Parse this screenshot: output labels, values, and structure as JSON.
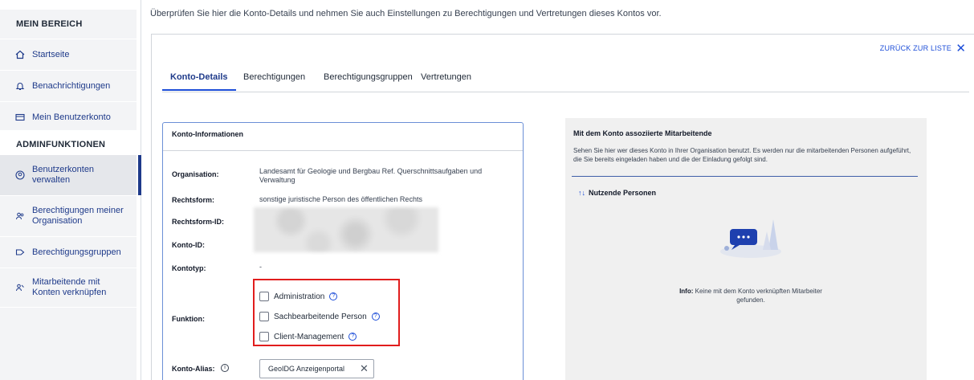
{
  "sidebar": {
    "section1": "MEIN BEREICH",
    "items1": [
      {
        "label": "Startseite",
        "icon": "home-icon"
      },
      {
        "label": "Benachrichtigungen",
        "icon": "bell-icon"
      },
      {
        "label": "Mein Benutzerkonto",
        "icon": "card-icon"
      }
    ],
    "section2": "ADMINFUNKTIONEN",
    "items2": [
      {
        "label": "Benutzerkonten verwalten",
        "icon": "user-circle-icon",
        "active": true
      },
      {
        "label": "Berechtigungen meiner Organisation",
        "icon": "users-icon"
      },
      {
        "label": "Berechtigungsgruppen",
        "icon": "tag-icon"
      },
      {
        "label": "Mitarbeitende mit Konten verknüpfen",
        "icon": "link-users-icon"
      }
    ]
  },
  "intro": "Überprüfen Sie hier die Konto-Details und nehmen Sie auch Einstellungen zu Berechtigungen und Vertretungen dieses Kontos vor.",
  "header": {
    "back_label": "ZURÜCK ZUR LISTE",
    "close_glyph": "✕"
  },
  "tabs": [
    "Konto-Details",
    "Berechtigungen",
    "Berechtigungsgruppen",
    "Vertretungen"
  ],
  "info": {
    "title": "Konto-Informationen",
    "org_label": "Organisation:",
    "org_value": "Landesamt für Geologie und Bergbau Ref. Querschnittsaufgaben und Verwaltung",
    "rechtsform_label": "Rechtsform:",
    "rechtsform_value": "sonstige juristische Person des öffentlichen Rechts",
    "rechtsform_id_label": "Rechtsform-ID:",
    "konto_id_label": "Konto-ID:",
    "kontotyp_label": "Kontotyp:",
    "kontotyp_value": "-",
    "funktion_label": "Funktion:",
    "funktionen": [
      "Administration",
      "Sachbearbeitende Person",
      "Client-Management"
    ],
    "alias_label": "Konto-Alias:",
    "alias_value": "GeoIDG Anzeigenportal"
  },
  "assoc": {
    "title": "Mit dem Konto assoziierte Mitarbeitende",
    "desc": "Sehen Sie hier wer dieses Konto in Ihrer Organisation benutzt. Es werden nur die mitarbeitenden Personen aufgeführt, die Sie bereits eingeladen haben und die der Einladung gefolgt sind.",
    "sort_label": "Nutzende Personen",
    "empty_prefix": "Info:",
    "empty_text": "Keine mit dem Konto verknüpften Mitarbeiter gefunden."
  },
  "colors": {
    "accent": "#1e3a8a",
    "highlight": "#e11d1d"
  }
}
